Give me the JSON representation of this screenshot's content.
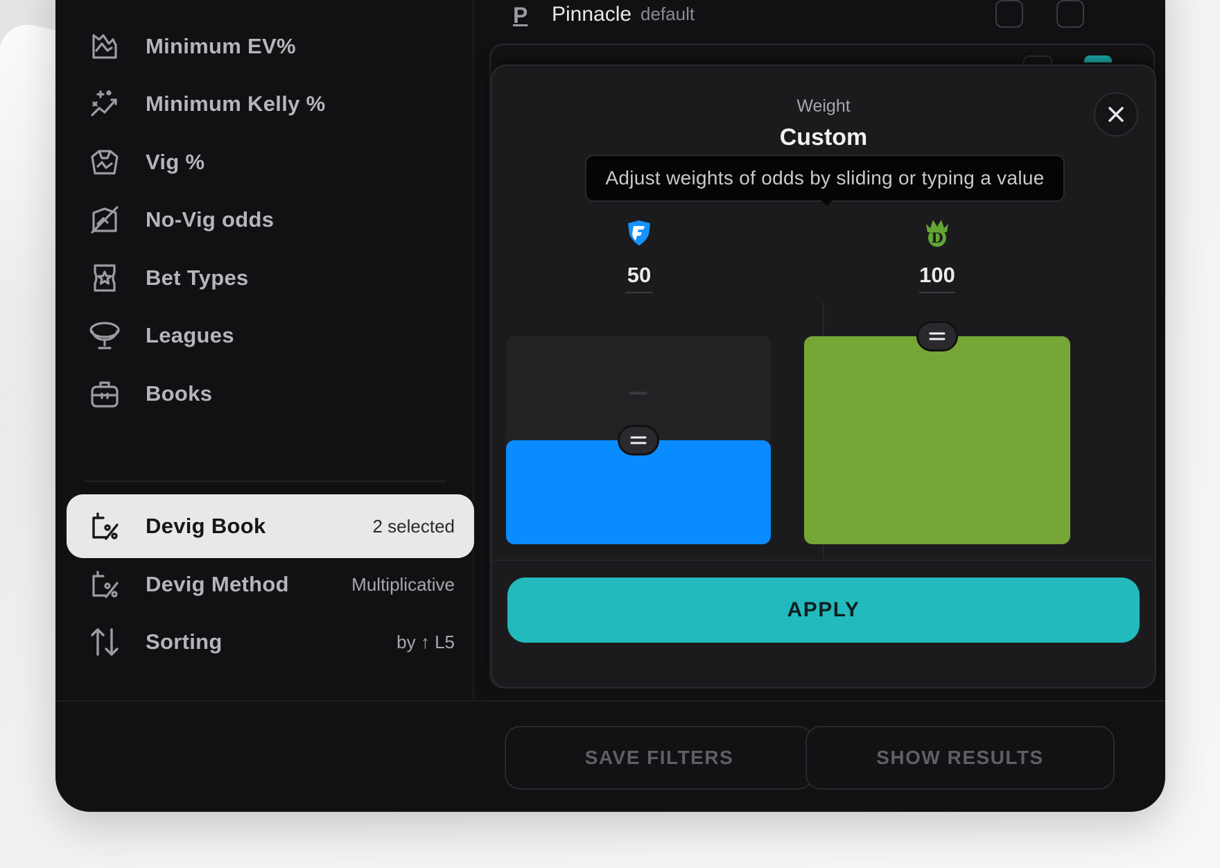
{
  "sidebar": {
    "items": [
      {
        "label": "Minimum EV%",
        "value": "",
        "icon": "ticket-ev-icon"
      },
      {
        "label": "Minimum Kelly %",
        "value": "",
        "icon": "sparkles-icon"
      },
      {
        "label": "Vig %",
        "value": "",
        "icon": "ticket-vig-icon"
      },
      {
        "label": "No-Vig odds",
        "value": "",
        "icon": "no-vig-icon"
      },
      {
        "label": "Bet Types",
        "value": "",
        "icon": "ticket-star-icon"
      },
      {
        "label": "Leagues",
        "value": "",
        "icon": "trophy-icon"
      },
      {
        "label": "Books",
        "value": "",
        "icon": "briefcase-icon"
      },
      {
        "label": "Devig Book",
        "value": "2 selected",
        "icon": "percent-bag-icon"
      },
      {
        "label": "Devig Method",
        "value": "Multiplicative",
        "icon": "percent-bag-icon"
      },
      {
        "label": "Sorting",
        "value": "by ↑ L5",
        "icon": "sort-arrows-icon"
      }
    ]
  },
  "book_row": {
    "logo": "P",
    "name": "Pinnacle",
    "tag": "default"
  },
  "modal": {
    "subtitle": "Weight",
    "title": "Custom",
    "tooltip": "Adjust weights of odds by sliding or typing a value",
    "apply_label": "APPLY",
    "books": [
      {
        "name": "FanDuel",
        "icon": "fanduel-shield-icon",
        "value": "50",
        "level": 0.5,
        "color": "#0a8bff"
      },
      {
        "name": "DraftKings",
        "icon": "draftkings-crown-icon",
        "value": "100",
        "level": 1.0,
        "color": "#75a636"
      }
    ]
  },
  "footer": {
    "save_label": "SAVE FILTERS",
    "show_label": "SHOW RESULTS"
  },
  "colors": {
    "accent": "#22babd",
    "background": "#111113",
    "active_item": "#e8e7ea"
  }
}
